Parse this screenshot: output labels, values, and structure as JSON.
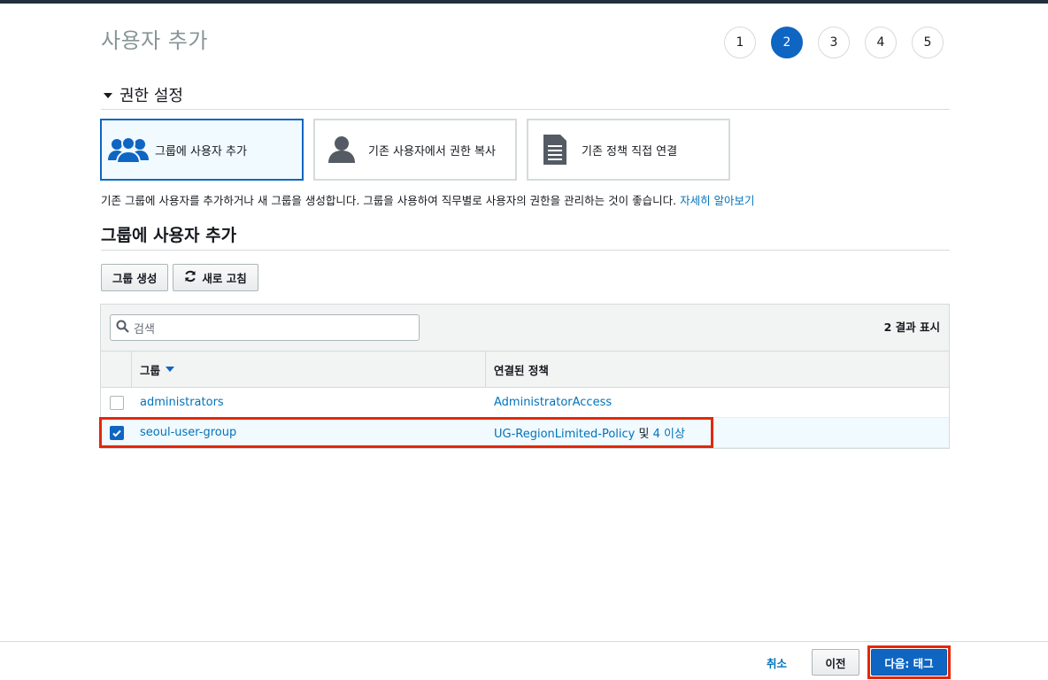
{
  "page": {
    "title": "사용자 추가"
  },
  "steps": [
    {
      "label": "1",
      "active": false
    },
    {
      "label": "2",
      "active": true
    },
    {
      "label": "3",
      "active": false
    },
    {
      "label": "4",
      "active": false
    },
    {
      "label": "5",
      "active": false
    }
  ],
  "permissions": {
    "section_label": "권한 설정",
    "options": [
      {
        "label": "그룹에 사용자 추가",
        "icon": "group-icon",
        "selected": true
      },
      {
        "label": "기존 사용자에서 권한 복사",
        "icon": "user-icon",
        "selected": false
      },
      {
        "label": "기존 정책 직접 연결",
        "icon": "document-icon",
        "selected": false
      }
    ],
    "description": "기존 그룹에 사용자를 추가하거나 새 그룹을 생성합니다. 그룹을 사용하여 직무별로 사용자의 권한을 관리하는 것이 좋습니다.",
    "learn_more": "자세히 알아보기"
  },
  "group_section": {
    "heading": "그룹에 사용자 추가",
    "create_group_label": "그룹 생성",
    "refresh_label": "새로 고침",
    "search_placeholder": "검색",
    "result_count": "2 결과 표시",
    "columns": {
      "group": "그룹",
      "policies": "연결된 정책"
    },
    "rows": [
      {
        "group": "administrators",
        "policy": "AdministratorAccess",
        "and": "",
        "more": "",
        "checked": false
      },
      {
        "group": "seoul-user-group",
        "policy": "UG-RegionLimited-Policy",
        "and": " 및 ",
        "more": "4 이상",
        "checked": true
      }
    ]
  },
  "footer": {
    "cancel_label": "취소",
    "prev_label": "이전",
    "next_label": "다음: 태그"
  },
  "colors": {
    "accent": "#0f65c2",
    "link": "#0073bb",
    "highlight": "#e2280d"
  }
}
